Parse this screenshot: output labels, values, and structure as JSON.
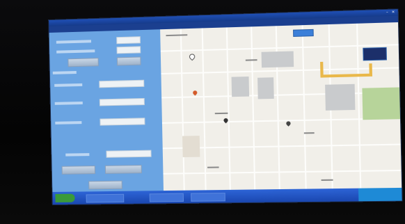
{
  "app": {
    "title": ""
  },
  "menubar": {
    "items": [
      "",
      "",
      "",
      "",
      "",
      "",
      "",
      "",
      ""
    ]
  },
  "colors": {
    "titlebar": "#1f4fb5",
    "left_panel": "#6aa4e2",
    "map_background": "#f1efe9",
    "route": "#e9b84a",
    "taskbar": "#2d64d6"
  },
  "icons": {
    "close": "close-icon",
    "minimize": "minimize-icon",
    "map_pins": [
      "map-pin-icon",
      "map-pin-icon",
      "map-pin-icon",
      "map-pin-icon"
    ],
    "zoom": "zoom-control"
  }
}
